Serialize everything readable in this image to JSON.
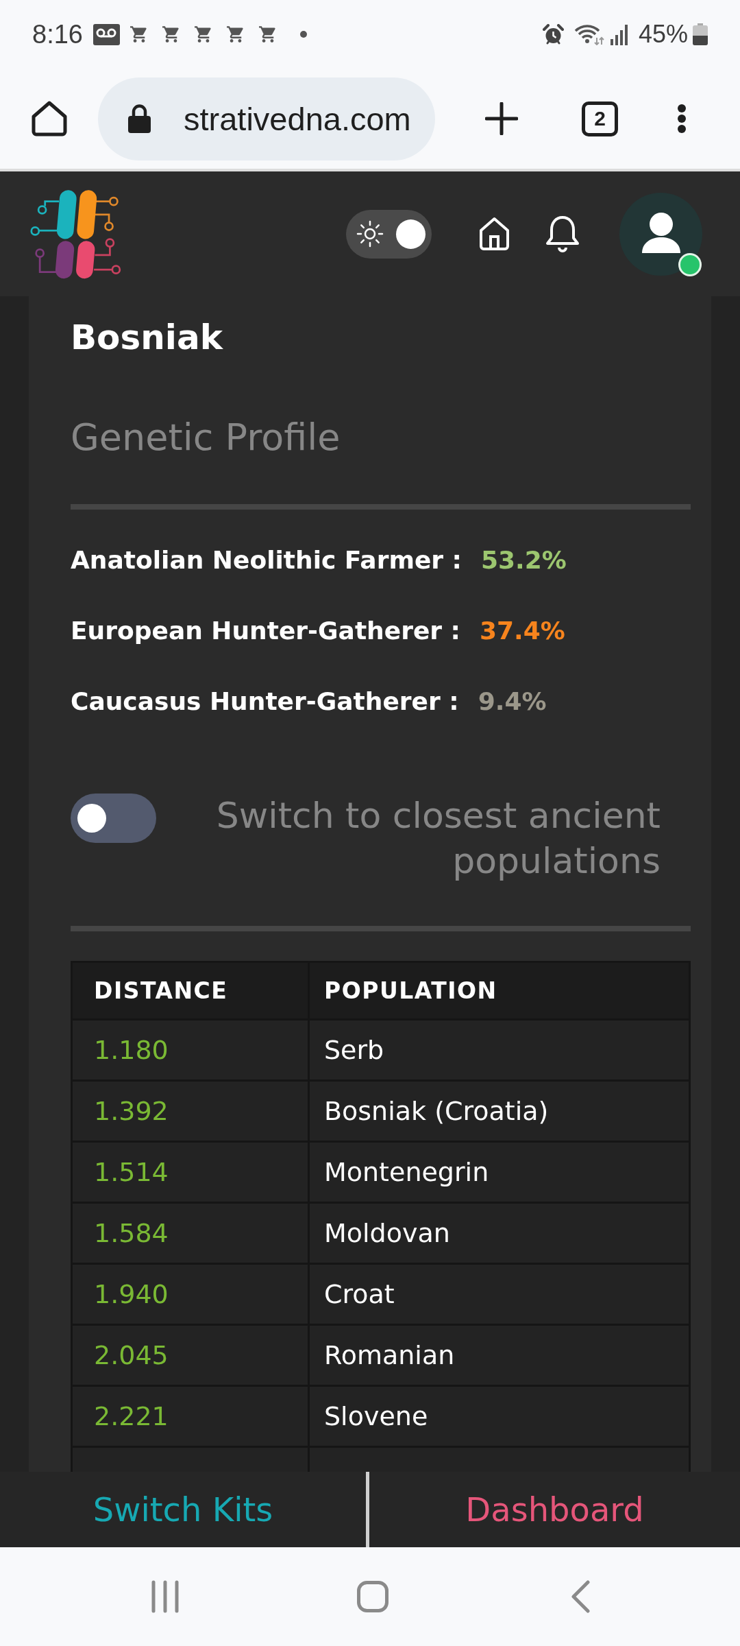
{
  "status_bar": {
    "time": "8:16",
    "battery": "45%"
  },
  "browser": {
    "url": "strativedna.com",
    "tab_count": "2"
  },
  "header": {
    "theme_toggle": {
      "on": true
    },
    "avatar": {
      "online": true
    }
  },
  "profile": {
    "title": "Bosniak",
    "subtitle": "Genetic Profile",
    "components": [
      {
        "label": "Anatolian Neolithic Farmer :",
        "value": "53.2%",
        "color": "#9cc66f"
      },
      {
        "label": "European Hunter-Gatherer :",
        "value": "37.4%",
        "color": "#f7841d"
      },
      {
        "label": "Caucasus Hunter-Gatherer :",
        "value": "9.4%",
        "color": "#9b978a"
      }
    ]
  },
  "ancient_switch": {
    "label": "Switch to closest ancient populations",
    "on": false
  },
  "table": {
    "columns": [
      "DISTANCE",
      "POPULATION"
    ],
    "rows": [
      {
        "distance": "1.180",
        "population": "Serb"
      },
      {
        "distance": "1.392",
        "population": "Bosniak (Croatia)"
      },
      {
        "distance": "1.514",
        "population": "Montenegrin"
      },
      {
        "distance": "1.584",
        "population": "Moldovan"
      },
      {
        "distance": "1.940",
        "population": "Croat"
      },
      {
        "distance": "2.045",
        "population": "Romanian"
      },
      {
        "distance": "2.221",
        "population": "Slovene"
      }
    ]
  },
  "bottom_bar": {
    "buttons": [
      {
        "label": "Switch Kits",
        "color": "#17a9b3"
      },
      {
        "label": "Dashboard",
        "color": "#e5567a"
      }
    ]
  }
}
